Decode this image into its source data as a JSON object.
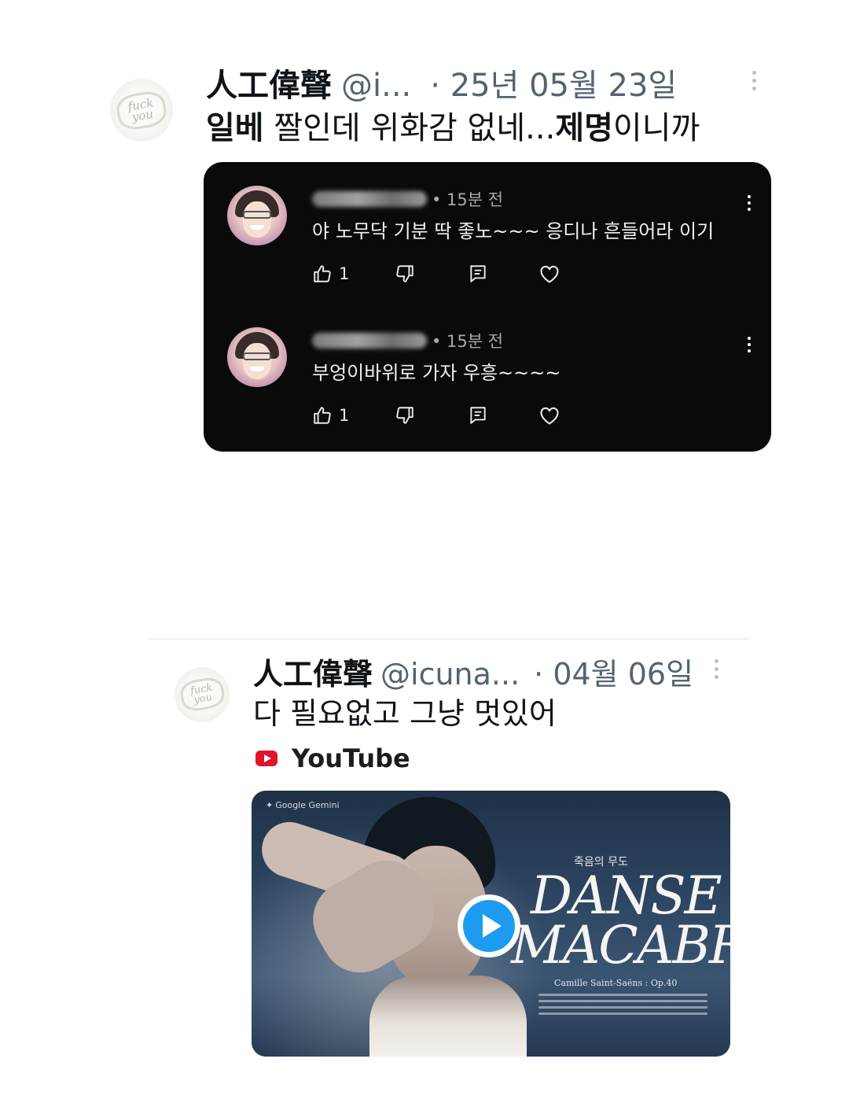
{
  "tweet1": {
    "display_name": "人工偉聲",
    "handle": "@i...",
    "date": "· 25년 05월 23일",
    "text_parts": [
      "일베",
      " 짤인데 위화감 없네...",
      "제명",
      "이니까"
    ],
    "avatar_logo": "fuck you"
  },
  "embedded_comments": [
    {
      "time": "• 15분 전",
      "text": "야 노무닥 기분 딱 좋노~~~ 응디나 흔들어라 이기",
      "like_count": "1",
      "icons": [
        "thumbs-up-icon",
        "thumbs-down-icon",
        "reply-icon",
        "heart-icon",
        "more-vertical-icon"
      ]
    },
    {
      "time": "• 15분 전",
      "text": "부엉이바위로 가자 우흥~~~~",
      "like_count": "1",
      "icons": [
        "thumbs-up-icon",
        "thumbs-down-icon",
        "reply-icon",
        "heart-icon",
        "more-vertical-icon"
      ]
    }
  ],
  "tweet2": {
    "display_name": "人工偉聲",
    "handle": "@icuna...",
    "date": "· 04월 06일",
    "text": "다 필요없고 그냥 멋있어",
    "avatar_logo": "fuck you",
    "card_source": "YouTube",
    "video": {
      "badge": "Google Gemini",
      "kr_title": "죽음의 무도",
      "title_line1": "DANSE",
      "title_line2": "MACABRE",
      "composer": "Camille Saint-Saëns : Op.40"
    }
  },
  "colors": {
    "accent_blue": "#1d9bf0",
    "youtube_red": "#e0132b",
    "muted_text": "#536471",
    "dark_card": "#0a0a0a"
  }
}
